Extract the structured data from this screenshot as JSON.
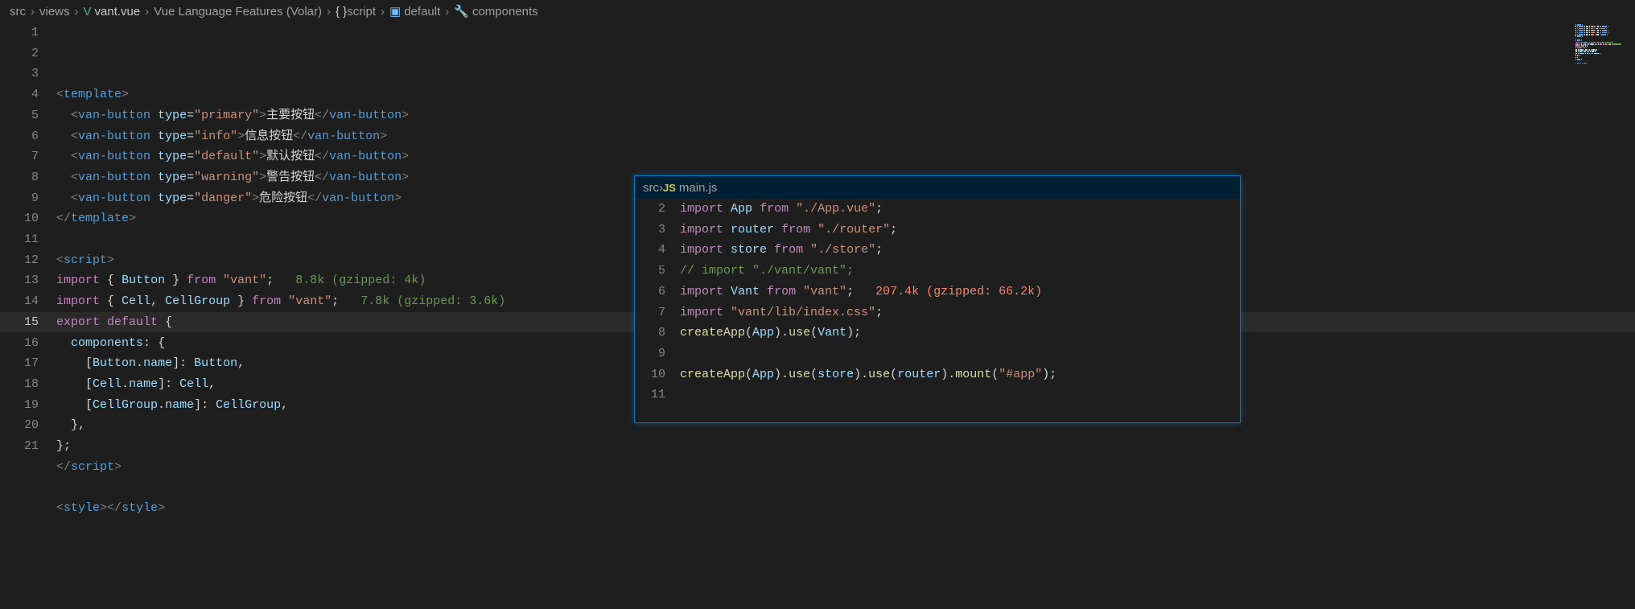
{
  "breadcrumb": {
    "items": [
      "src",
      "views",
      "vant.vue",
      "Vue Language Features (Volar)",
      "script",
      "default",
      "components"
    ],
    "brace_label": "{ }",
    "var_icon": "⬚",
    "wrench_icon": "🔧"
  },
  "main_editor": {
    "line_start": 1,
    "active_line": 15,
    "lines": [
      {
        "n": 1,
        "t": [
          [
            "gray",
            "<"
          ],
          [
            "blue-tag",
            "template"
          ],
          [
            "gray",
            ">"
          ]
        ]
      },
      {
        "n": 2,
        "t": [
          [
            "text",
            "  "
          ],
          [
            "gray",
            "<"
          ],
          [
            "blue-tag",
            "van-button"
          ],
          [
            "text",
            " "
          ],
          [
            "attr",
            "type"
          ],
          [
            "punct",
            "="
          ],
          [
            "string",
            "\"primary\""
          ],
          [
            "gray",
            ">"
          ],
          [
            "text",
            "主要按钮"
          ],
          [
            "gray",
            "</"
          ],
          [
            "blue-tag",
            "van-button"
          ],
          [
            "gray",
            ">"
          ]
        ]
      },
      {
        "n": 3,
        "t": [
          [
            "text",
            "  "
          ],
          [
            "gray",
            "<"
          ],
          [
            "blue-tag",
            "van-button"
          ],
          [
            "text",
            " "
          ],
          [
            "attr",
            "type"
          ],
          [
            "punct",
            "="
          ],
          [
            "string",
            "\"info\""
          ],
          [
            "gray",
            ">"
          ],
          [
            "text",
            "信息按钮"
          ],
          [
            "gray",
            "</"
          ],
          [
            "blue-tag",
            "van-button"
          ],
          [
            "gray",
            ">"
          ]
        ]
      },
      {
        "n": 4,
        "t": [
          [
            "text",
            "  "
          ],
          [
            "gray",
            "<"
          ],
          [
            "blue-tag",
            "van-button"
          ],
          [
            "text",
            " "
          ],
          [
            "attr",
            "type"
          ],
          [
            "punct",
            "="
          ],
          [
            "string",
            "\"default\""
          ],
          [
            "gray",
            ">"
          ],
          [
            "text",
            "默认按钮"
          ],
          [
            "gray",
            "</"
          ],
          [
            "blue-tag",
            "van-button"
          ],
          [
            "gray",
            ">"
          ]
        ]
      },
      {
        "n": 5,
        "t": [
          [
            "text",
            "  "
          ],
          [
            "gray",
            "<"
          ],
          [
            "blue-tag",
            "van-button"
          ],
          [
            "text",
            " "
          ],
          [
            "attr",
            "type"
          ],
          [
            "punct",
            "="
          ],
          [
            "string",
            "\"warning\""
          ],
          [
            "gray",
            ">"
          ],
          [
            "text",
            "警告按钮"
          ],
          [
            "gray",
            "</"
          ],
          [
            "blue-tag",
            "van-button"
          ],
          [
            "gray",
            ">"
          ]
        ]
      },
      {
        "n": 6,
        "t": [
          [
            "text",
            "  "
          ],
          [
            "gray",
            "<"
          ],
          [
            "blue-tag",
            "van-button"
          ],
          [
            "text",
            " "
          ],
          [
            "attr",
            "type"
          ],
          [
            "punct",
            "="
          ],
          [
            "string",
            "\"danger\""
          ],
          [
            "gray",
            ">"
          ],
          [
            "text",
            "危险按钮"
          ],
          [
            "gray",
            "</"
          ],
          [
            "blue-tag",
            "van-button"
          ],
          [
            "gray",
            ">"
          ]
        ]
      },
      {
        "n": 7,
        "t": [
          [
            "gray",
            "</"
          ],
          [
            "blue-tag",
            "template"
          ],
          [
            "gray",
            ">"
          ]
        ]
      },
      {
        "n": 8,
        "t": []
      },
      {
        "n": 9,
        "t": [
          [
            "gray",
            "<"
          ],
          [
            "blue-tag",
            "script"
          ],
          [
            "gray",
            ">"
          ]
        ]
      },
      {
        "n": 10,
        "t": [
          [
            "keyword-pink",
            "import"
          ],
          [
            "text",
            " "
          ],
          [
            "punct",
            "{"
          ],
          [
            "text",
            " "
          ],
          [
            "ident",
            "Button"
          ],
          [
            "text",
            " "
          ],
          [
            "punct",
            "}"
          ],
          [
            "text",
            " "
          ],
          [
            "keyword-pink",
            "from"
          ],
          [
            "text",
            " "
          ],
          [
            "string",
            "\"vant\""
          ],
          [
            "punct",
            ";"
          ],
          [
            "text",
            "   "
          ],
          [
            "comment-green",
            "8.8k (gzipped: 4k)"
          ]
        ]
      },
      {
        "n": 11,
        "t": [
          [
            "keyword-pink",
            "import"
          ],
          [
            "text",
            " "
          ],
          [
            "punct",
            "{"
          ],
          [
            "text",
            " "
          ],
          [
            "ident",
            "Cell"
          ],
          [
            "punct",
            ","
          ],
          [
            "text",
            " "
          ],
          [
            "ident",
            "CellGroup"
          ],
          [
            "text",
            " "
          ],
          [
            "punct",
            "}"
          ],
          [
            "text",
            " "
          ],
          [
            "keyword-pink",
            "from"
          ],
          [
            "text",
            " "
          ],
          [
            "string",
            "\"vant\""
          ],
          [
            "punct",
            ";"
          ],
          [
            "text",
            "   "
          ],
          [
            "comment-green",
            "7.8k (gzipped: 3.6k)"
          ]
        ]
      },
      {
        "n": 12,
        "t": [
          [
            "keyword-pink",
            "export"
          ],
          [
            "text",
            " "
          ],
          [
            "keyword-pink",
            "default"
          ],
          [
            "text",
            " "
          ],
          [
            "punct",
            "{"
          ]
        ]
      },
      {
        "n": 13,
        "t": [
          [
            "text",
            "  "
          ],
          [
            "ident",
            "components"
          ],
          [
            "punct",
            ":"
          ],
          [
            "text",
            " "
          ],
          [
            "punct",
            "{"
          ]
        ]
      },
      {
        "n": 14,
        "t": [
          [
            "text",
            "    "
          ],
          [
            "punct",
            "["
          ],
          [
            "ident",
            "Button"
          ],
          [
            "punct",
            "."
          ],
          [
            "ident",
            "name"
          ],
          [
            "punct",
            "]"
          ],
          [
            "punct",
            ":"
          ],
          [
            "text",
            " "
          ],
          [
            "ident",
            "Button"
          ],
          [
            "punct",
            ","
          ]
        ]
      },
      {
        "n": 15,
        "t": [
          [
            "text",
            "    "
          ],
          [
            "punct",
            "["
          ],
          [
            "ident",
            "Cell"
          ],
          [
            "punct",
            "."
          ],
          [
            "ident",
            "name"
          ],
          [
            "punct",
            "]"
          ],
          [
            "punct",
            ":"
          ],
          [
            "text",
            " "
          ],
          [
            "ident",
            "Cell"
          ],
          [
            "punct",
            ","
          ]
        ]
      },
      {
        "n": 16,
        "t": [
          [
            "text",
            "    "
          ],
          [
            "punct",
            "["
          ],
          [
            "ident",
            "CellGroup"
          ],
          [
            "punct",
            "."
          ],
          [
            "ident",
            "name"
          ],
          [
            "punct",
            "]"
          ],
          [
            "punct",
            ":"
          ],
          [
            "text",
            " "
          ],
          [
            "ident",
            "CellGroup"
          ],
          [
            "punct",
            ","
          ]
        ]
      },
      {
        "n": 17,
        "t": [
          [
            "text",
            "  "
          ],
          [
            "punct",
            "}"
          ],
          [
            "punct",
            ","
          ]
        ]
      },
      {
        "n": 18,
        "t": [
          [
            "punct",
            "}"
          ],
          [
            "punct",
            ";"
          ]
        ]
      },
      {
        "n": 19,
        "t": [
          [
            "gray",
            "</"
          ],
          [
            "blue-tag",
            "script"
          ],
          [
            "gray",
            ">"
          ]
        ]
      },
      {
        "n": 20,
        "t": []
      },
      {
        "n": 21,
        "t": [
          [
            "gray",
            "<"
          ],
          [
            "blue-tag",
            "style"
          ],
          [
            "gray",
            ">"
          ],
          [
            "gray",
            "</"
          ],
          [
            "blue-tag",
            "style"
          ],
          [
            "gray",
            ">"
          ]
        ]
      }
    ]
  },
  "peek": {
    "crumb": {
      "folder": "src",
      "file": "main.js"
    },
    "lines": [
      {
        "n": 2,
        "t": [
          [
            "keyword-pink",
            "import"
          ],
          [
            "text",
            " "
          ],
          [
            "ident",
            "App"
          ],
          [
            "text",
            " "
          ],
          [
            "keyword-pink",
            "from"
          ],
          [
            "text",
            " "
          ],
          [
            "string",
            "\"./App.vue\""
          ],
          [
            "punct",
            ";"
          ]
        ]
      },
      {
        "n": 3,
        "t": [
          [
            "keyword-pink",
            "import"
          ],
          [
            "text",
            " "
          ],
          [
            "ident",
            "router"
          ],
          [
            "text",
            " "
          ],
          [
            "keyword-pink",
            "from"
          ],
          [
            "text",
            " "
          ],
          [
            "string",
            "\"./router\""
          ],
          [
            "punct",
            ";"
          ]
        ]
      },
      {
        "n": 4,
        "t": [
          [
            "keyword-pink",
            "import"
          ],
          [
            "text",
            " "
          ],
          [
            "ident",
            "store"
          ],
          [
            "text",
            " "
          ],
          [
            "keyword-pink",
            "from"
          ],
          [
            "text",
            " "
          ],
          [
            "string",
            "\"./store\""
          ],
          [
            "punct",
            ";"
          ]
        ]
      },
      {
        "n": 5,
        "t": [
          [
            "comment-green",
            "// import \"./vant/vant\";"
          ]
        ]
      },
      {
        "n": 6,
        "t": [
          [
            "keyword-pink",
            "import"
          ],
          [
            "text",
            " "
          ],
          [
            "ident",
            "Vant"
          ],
          [
            "text",
            " "
          ],
          [
            "keyword-pink",
            "from"
          ],
          [
            "text",
            " "
          ],
          [
            "string",
            "\"vant\""
          ],
          [
            "punct",
            ";"
          ],
          [
            "text",
            "   "
          ],
          [
            "hint-red",
            "207.4k (gzipped: 66.2k)"
          ]
        ]
      },
      {
        "n": 7,
        "t": [
          [
            "keyword-pink",
            "import"
          ],
          [
            "text",
            " "
          ],
          [
            "string",
            "\"vant/lib/index.css\""
          ],
          [
            "punct",
            ";"
          ]
        ]
      },
      {
        "n": 8,
        "t": [
          [
            "func",
            "createApp"
          ],
          [
            "punct",
            "("
          ],
          [
            "ident",
            "App"
          ],
          [
            "punct",
            ")"
          ],
          [
            "punct",
            "."
          ],
          [
            "func",
            "use"
          ],
          [
            "punct",
            "("
          ],
          [
            "ident",
            "Vant"
          ],
          [
            "punct",
            ")"
          ],
          [
            "punct",
            ";"
          ]
        ]
      },
      {
        "n": 9,
        "t": []
      },
      {
        "n": 10,
        "t": [
          [
            "func",
            "createApp"
          ],
          [
            "punct",
            "("
          ],
          [
            "ident",
            "App"
          ],
          [
            "punct",
            ")"
          ],
          [
            "punct",
            "."
          ],
          [
            "func",
            "use"
          ],
          [
            "punct",
            "("
          ],
          [
            "ident",
            "store"
          ],
          [
            "punct",
            ")"
          ],
          [
            "punct",
            "."
          ],
          [
            "func",
            "use"
          ],
          [
            "punct",
            "("
          ],
          [
            "ident",
            "router"
          ],
          [
            "punct",
            ")"
          ],
          [
            "punct",
            "."
          ],
          [
            "func",
            "mount"
          ],
          [
            "punct",
            "("
          ],
          [
            "string",
            "\"#app\""
          ],
          [
            "punct",
            ")"
          ],
          [
            "punct",
            ";"
          ]
        ]
      },
      {
        "n": 11,
        "t": []
      }
    ]
  }
}
